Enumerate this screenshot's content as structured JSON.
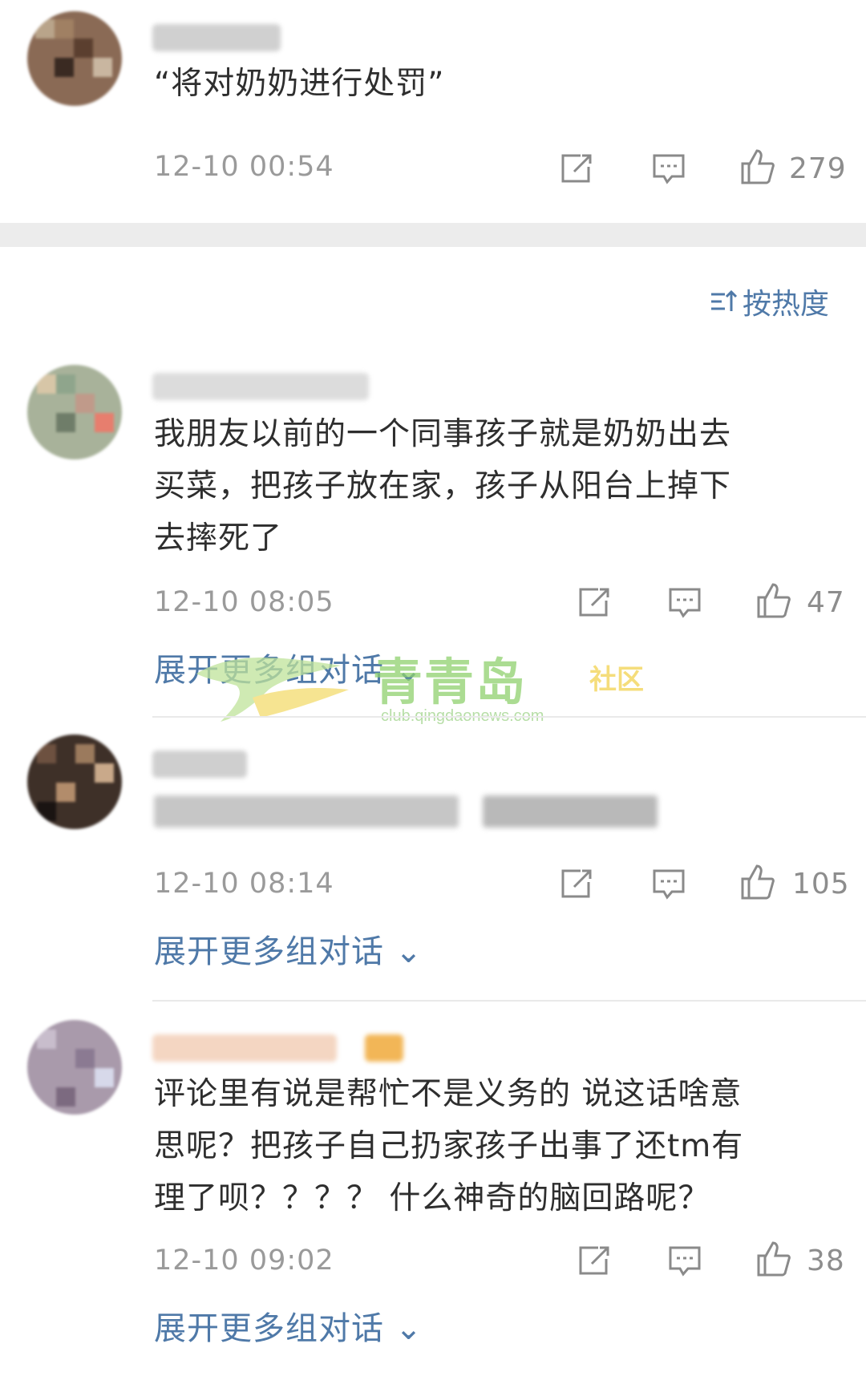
{
  "sort": {
    "icon": "sort-icon",
    "label": "按热度"
  },
  "actions": {
    "share_icon": "share-icon",
    "comment_icon": "comment-icon",
    "like_icon": "thumbs-up-icon"
  },
  "expand_label": "展开更多组对话",
  "top_comment": {
    "text": "“将对奶奶进行处罚”",
    "time": "12-10 00:54",
    "likes": "279"
  },
  "comments": [
    {
      "text": "我朋友以前的一个同事孩子就是奶奶出去\n买菜，把孩子放在家，孩子从阳台上掉下\n去摔死了",
      "time": "12-10 08:05",
      "likes": "47"
    },
    {
      "text": "",
      "time": "12-10 08:14",
      "likes": "105"
    },
    {
      "text": "评论里有说是帮忙不是义务的 说这话啥意\n思呢？把孩子自己扔家孩子出事了还tm有\n理了呗？？？？ 什么神奇的脑回路呢？",
      "time": "12-10 09:02",
      "likes": "38"
    }
  ],
  "watermark": {
    "title": "青青岛",
    "subtitle": "社区",
    "url": "club.qingdaonews.com"
  },
  "colors": {
    "link": "#4f79a8",
    "meta": "#9a9a9a",
    "text": "#2e2e2e",
    "separator": "#ececec"
  }
}
